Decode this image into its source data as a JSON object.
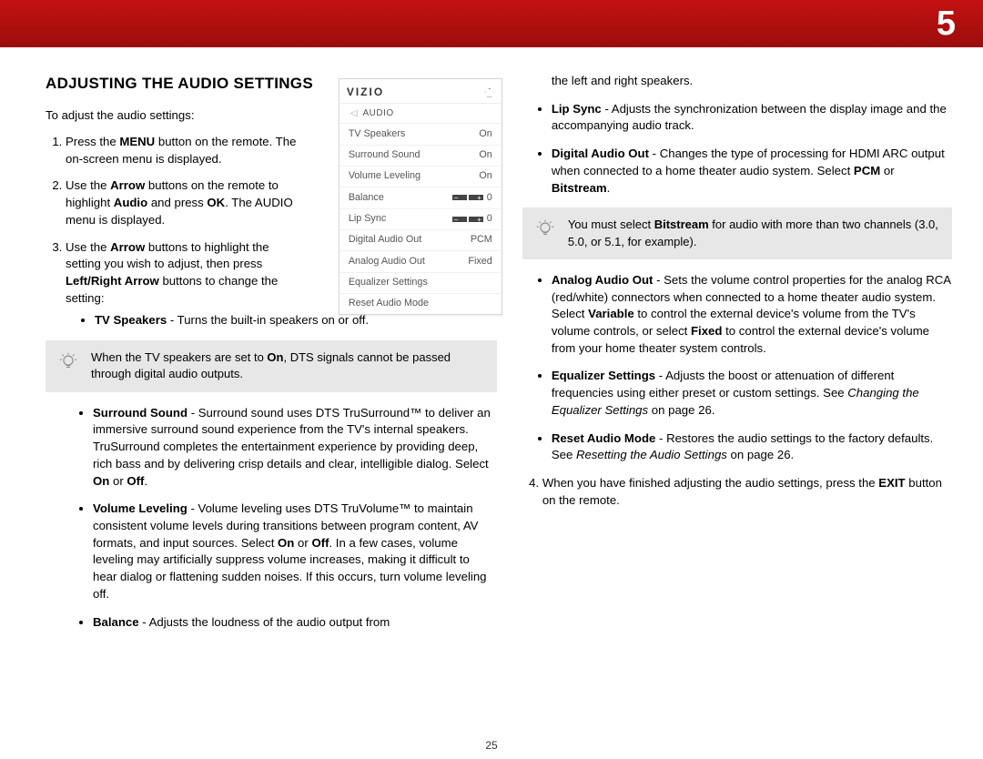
{
  "chapter": "5",
  "page_number": "25",
  "left": {
    "heading": "ADJUSTING THE AUDIO SETTINGS",
    "intro": "To adjust the audio settings:",
    "step1_a": "Press the ",
    "step1_b": "MENU",
    "step1_c": " button on the remote. The on-screen menu is displayed.",
    "step2_a": "Use the ",
    "step2_b": "Arrow",
    "step2_c": " buttons on the remote to highlight ",
    "step2_d": "Audio",
    "step2_e": " and press ",
    "step2_f": "OK",
    "step2_g": ". The AUDIO menu is displayed.",
    "step3_a": "Use the ",
    "step3_b": "Arrow",
    "step3_c": " buttons to highlight the setting you wish to adjust, then press ",
    "step3_d": "Left/Right Arrow",
    "step3_e": " buttons to change the setting:",
    "tvspk_b": "TV Speakers",
    "tvspk_t": " - Turns the built-in speakers on or off.",
    "tip1_a": "When the TV speakers are set to ",
    "tip1_b": "On",
    "tip1_c": ", DTS signals cannot be passed through digital audio outputs.",
    "sur_b": "Surround Sound",
    "sur_t": " - Surround sound uses DTS TruSurround™ to deliver an immersive surround sound experience from the TV's internal speakers. TruSurround completes the entertainment experience by providing deep, rich bass and by delivering crisp details and clear, intelligible dialog. Select ",
    "sur_on": "On",
    "sur_or": " or ",
    "sur_off": "Off",
    "sur_dot": ".",
    "vol_b": "Volume Leveling",
    "vol_t1": " - Volume leveling uses DTS TruVolume™ to maintain consistent volume levels during transitions between program content, AV formats, and input sources. Select ",
    "vol_on": "On",
    "vol_or": " or ",
    "vol_off": "Off",
    "vol_t2": ". In a few cases, volume leveling may artificially suppress volume increases, making it difficult to hear dialog or flattening sudden noises. If this occurs, turn volume leveling off.",
    "bal_b": "Balance",
    "bal_t": " - Adjusts the loudness of the audio output from "
  },
  "right": {
    "cont": "the left and right speakers.",
    "lip_b": "Lip Sync",
    "lip_t": " - Adjusts the synchronization between the display image and the accompanying audio track.",
    "dao_b": "Digital Audio Out",
    "dao_t1": " - Changes the type of processing for HDMI ARC output when connected to a home theater audio system. Select ",
    "dao_pcm": "PCM",
    "dao_or": " or ",
    "dao_bs": "Bitstream",
    "dao_dot": ".",
    "tip2_a": "You must select ",
    "tip2_b": "Bitstream",
    "tip2_c": " for audio with more than two channels (3.0, 5.0, or 5.1, for example).",
    "aao_b": "Analog Audio Out",
    "aao_t1": " - Sets the volume control properties for the analog RCA (red/white) connectors when connected to a home theater audio system. Select ",
    "aao_var": "Variable",
    "aao_t2": " to control the external device's volume from the TV's volume controls, or select ",
    "aao_fix": "Fixed",
    "aao_t3": " to control the external device's volume from your home theater system controls.",
    "eq_b": "Equalizer Settings",
    "eq_t1": " - Adjusts the boost or attenuation of different frequencies using either preset or custom settings. See ",
    "eq_i": "Changing the Equalizer Settings",
    "eq_t2": " on page 26.",
    "rst_b": "Reset Audio Mode",
    "rst_t1": " - Restores the audio settings to the factory defaults. See ",
    "rst_i": "Resetting the Audio Settings",
    "rst_t2": " on page 26.",
    "step4_a": "When you have finished adjusting the audio settings, press the ",
    "step4_b": "EXIT",
    "step4_c": " button on the remote."
  },
  "menu": {
    "logo": "VIZIO",
    "crumb": "AUDIO",
    "rows": [
      {
        "label": "TV Speakers",
        "value": "On"
      },
      {
        "label": "Surround Sound",
        "value": "On"
      },
      {
        "label": "Volume Leveling",
        "value": "On"
      },
      {
        "label": "Balance",
        "value": "0",
        "slider": true
      },
      {
        "label": "Lip Sync",
        "value": "0",
        "slider": true
      },
      {
        "label": "Digital Audio Out",
        "value": "PCM"
      },
      {
        "label": "Analog Audio Out",
        "value": "Fixed"
      },
      {
        "label": "Equalizer Settings",
        "value": ""
      },
      {
        "label": "Reset Audio Mode",
        "value": ""
      }
    ]
  }
}
